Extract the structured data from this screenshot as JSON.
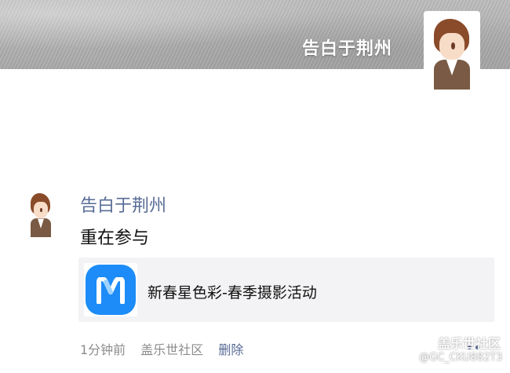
{
  "header": {
    "user_name": "告白于荆州"
  },
  "post": {
    "author": "告白于荆州",
    "text": "重在参与",
    "shared_link": {
      "title": "新春星色彩-春季摄影活动",
      "icon": "members-app-icon",
      "icon_color": "#1d8cf8"
    },
    "meta": {
      "time": "1分钟前",
      "source": "盖乐世社区",
      "delete_label": "删除"
    },
    "accent_color": "#576b95"
  },
  "watermark": {
    "title": "盖乐世社区",
    "user": "@GC_CKU882T3"
  }
}
